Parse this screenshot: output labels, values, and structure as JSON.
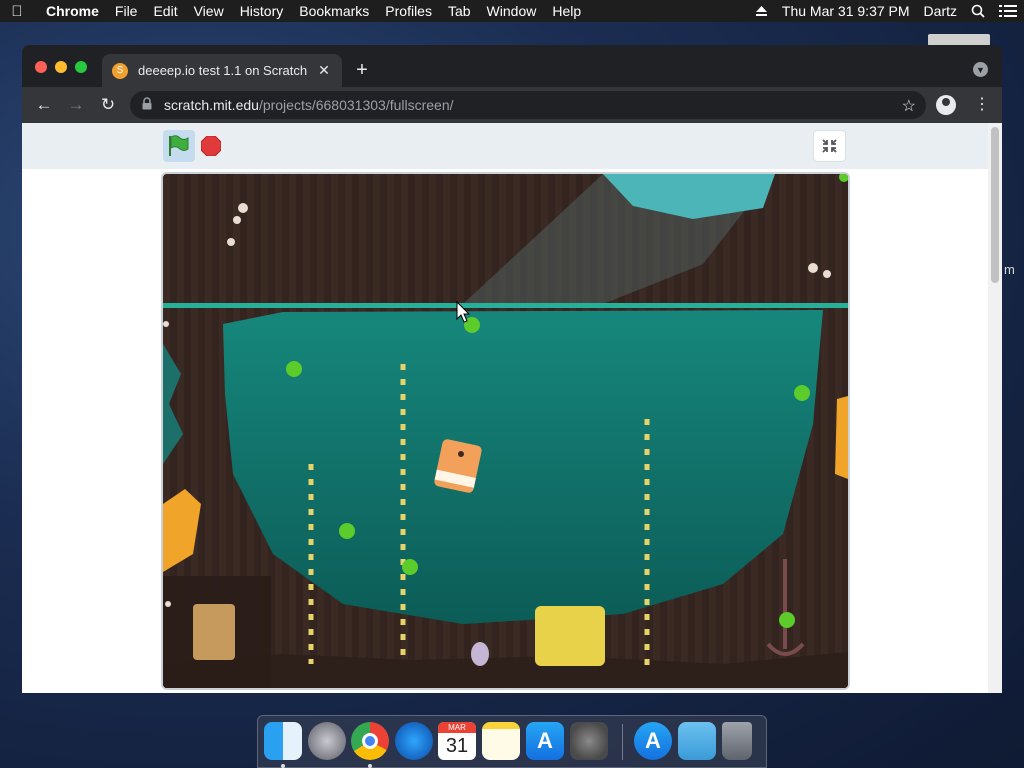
{
  "menubar": {
    "app_name": "Chrome",
    "items": [
      "File",
      "Edit",
      "View",
      "History",
      "Bookmarks",
      "Profiles",
      "Tab",
      "Window",
      "Help"
    ],
    "clock": "Thu Mar 31  9:37 PM",
    "user": "Dartz"
  },
  "browser": {
    "tab_title": "deeeep.io test 1.1 on Scratch",
    "url_host": "scratch.mit.edu",
    "url_path": "/projects/668031303/fullscreen/"
  },
  "dock": {
    "items": [
      "Finder",
      "Launchpad",
      "Chrome",
      "Safari",
      "Calendar",
      "Notes",
      "App Store",
      "System Preferences",
      "App Store",
      "Downloads",
      "Trash"
    ],
    "calendar_month": "MAR",
    "calendar_day": "31"
  },
  "colors": {
    "water": "#0f6e66",
    "seaweed": "#e6d36a",
    "food": "#5ccc2a",
    "player": "#f2a05a",
    "flag": "#3fae3f",
    "stop": "#e03a3a"
  },
  "offscreen_text": "m"
}
